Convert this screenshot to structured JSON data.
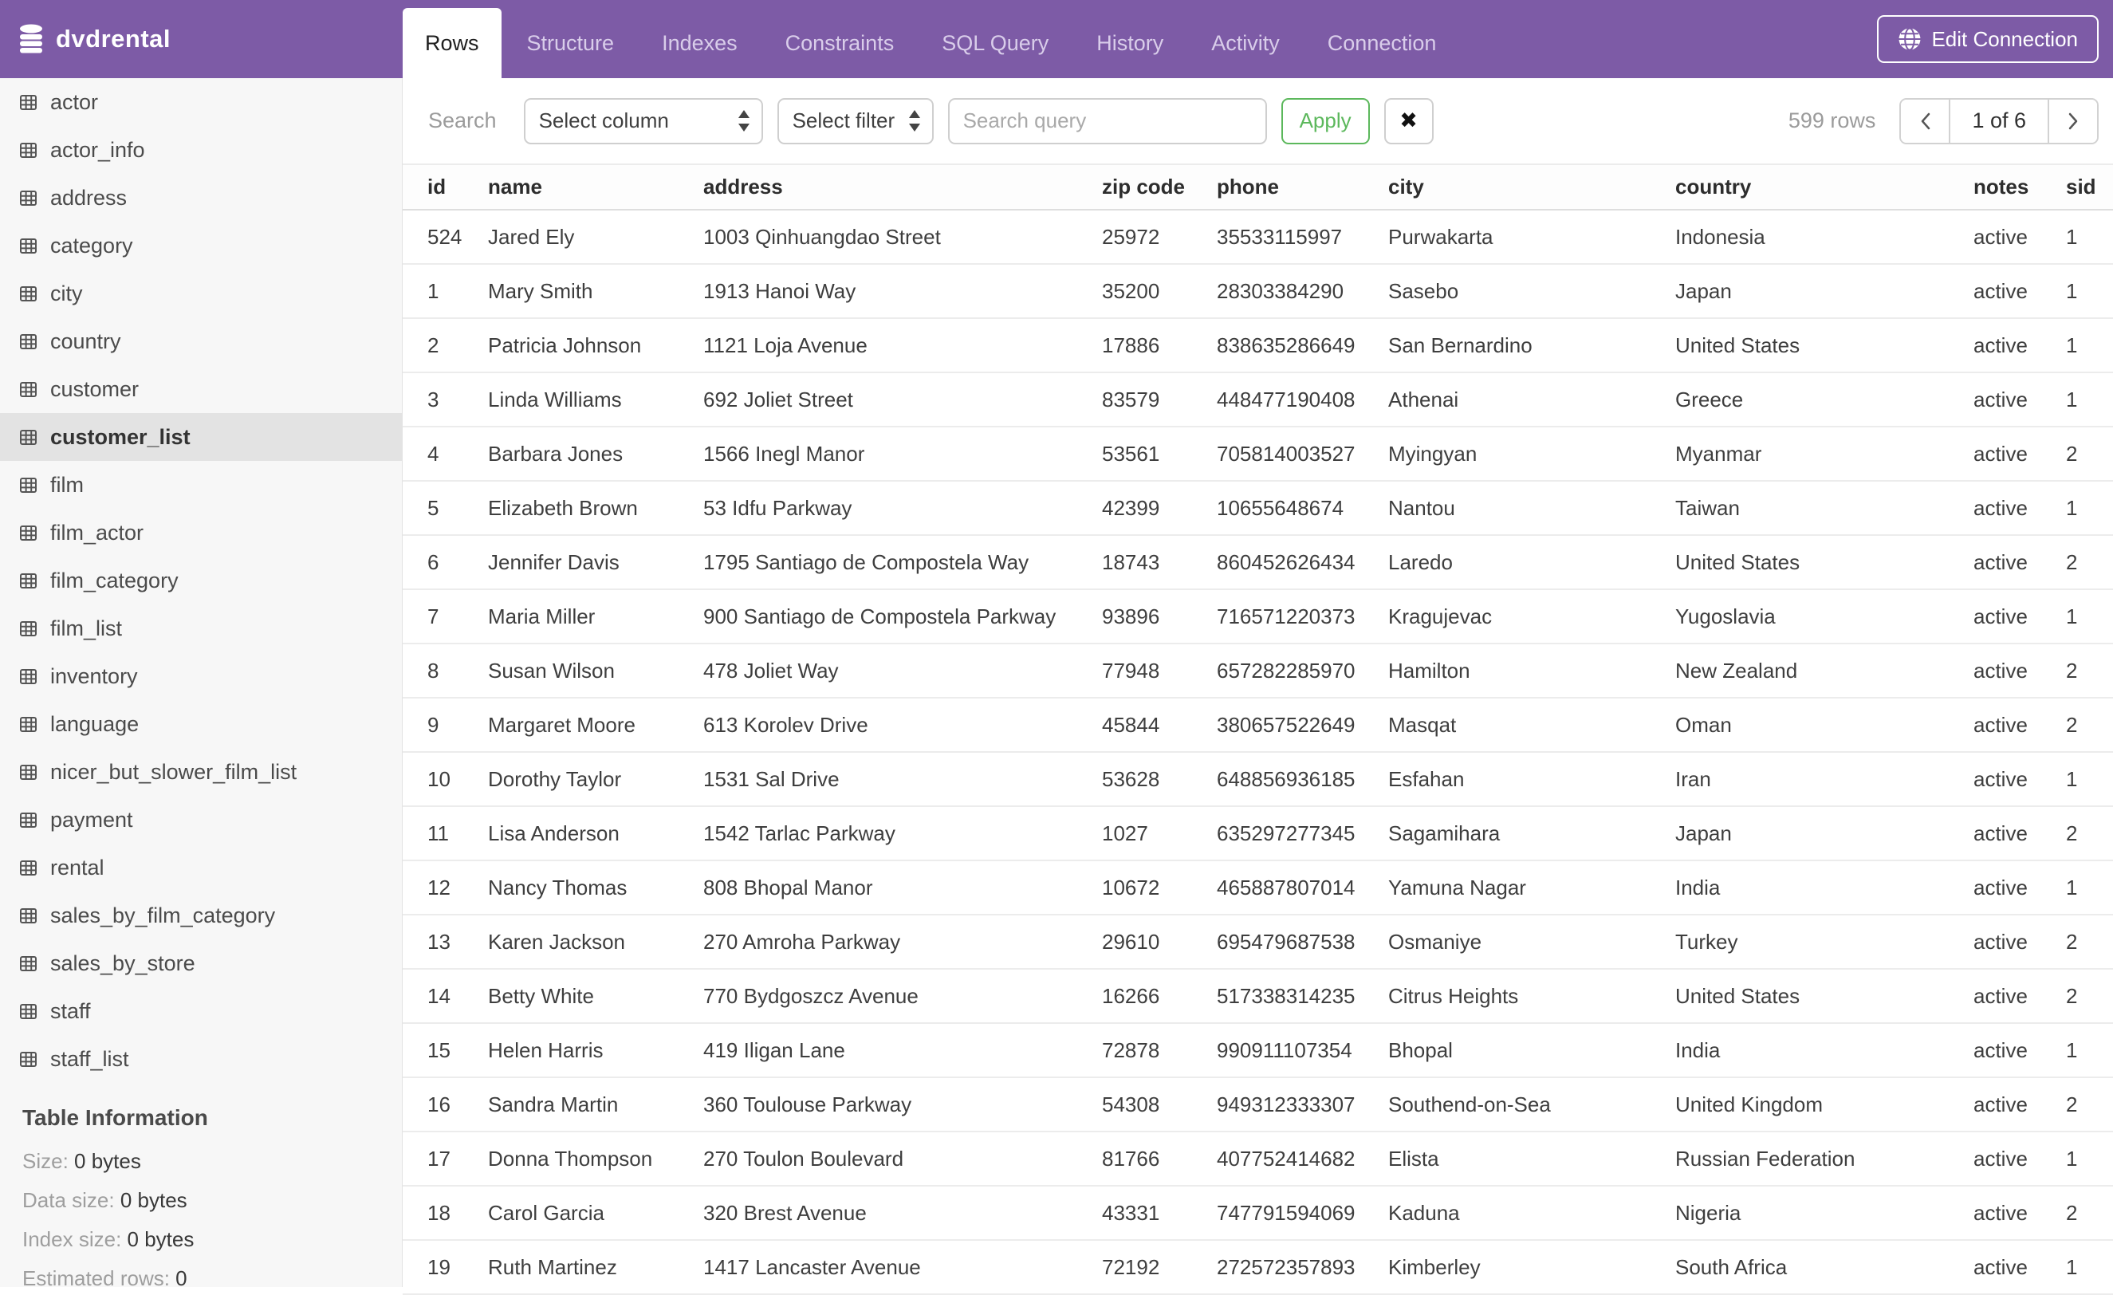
{
  "header": {
    "brand": "dvdrental",
    "tabs": [
      {
        "label": "Rows",
        "active": true
      },
      {
        "label": "Structure",
        "active": false
      },
      {
        "label": "Indexes",
        "active": false
      },
      {
        "label": "Constraints",
        "active": false
      },
      {
        "label": "SQL Query",
        "active": false
      },
      {
        "label": "History",
        "active": false
      },
      {
        "label": "Activity",
        "active": false
      },
      {
        "label": "Connection",
        "active": false
      }
    ],
    "edit_connection_label": "Edit Connection"
  },
  "toolbar": {
    "search_label": "Search",
    "column_select_value": "Select column",
    "filter_select_value": "Select filter",
    "query_placeholder": "Search query",
    "query_value": "",
    "apply_label": "Apply",
    "clear_label": "✖",
    "row_count": "599 rows",
    "page_indicator": "1 of 6"
  },
  "sidebar": {
    "selected_table": "customer_list",
    "tables": [
      "actor",
      "actor_info",
      "address",
      "category",
      "city",
      "country",
      "customer",
      "customer_list",
      "film",
      "film_actor",
      "film_category",
      "film_list",
      "inventory",
      "language",
      "nicer_but_slower_film_list",
      "payment",
      "rental",
      "sales_by_film_category",
      "sales_by_store",
      "staff",
      "staff_list"
    ],
    "info": {
      "heading": "Table Information",
      "items": [
        {
          "label": "Size:",
          "value": "0 bytes"
        },
        {
          "label": "Data size:",
          "value": "0 bytes"
        },
        {
          "label": "Index size:",
          "value": "0 bytes"
        },
        {
          "label": "Estimated rows:",
          "value": "0"
        }
      ]
    }
  },
  "table": {
    "columns": [
      "id",
      "name",
      "address",
      "zip code",
      "phone",
      "city",
      "country",
      "notes",
      "sid"
    ],
    "rows": [
      [
        "524",
        "Jared Ely",
        "1003 Qinhuangdao Street",
        "25972",
        "35533115997",
        "Purwakarta",
        "Indonesia",
        "active",
        "1"
      ],
      [
        "1",
        "Mary Smith",
        "1913 Hanoi Way",
        "35200",
        "28303384290",
        "Sasebo",
        "Japan",
        "active",
        "1"
      ],
      [
        "2",
        "Patricia Johnson",
        "1121 Loja Avenue",
        "17886",
        "838635286649",
        "San Bernardino",
        "United States",
        "active",
        "1"
      ],
      [
        "3",
        "Linda Williams",
        "692 Joliet Street",
        "83579",
        "448477190408",
        "Athenai",
        "Greece",
        "active",
        "1"
      ],
      [
        "4",
        "Barbara Jones",
        "1566 Inegl Manor",
        "53561",
        "705814003527",
        "Myingyan",
        "Myanmar",
        "active",
        "2"
      ],
      [
        "5",
        "Elizabeth Brown",
        "53 Idfu Parkway",
        "42399",
        "10655648674",
        "Nantou",
        "Taiwan",
        "active",
        "1"
      ],
      [
        "6",
        "Jennifer Davis",
        "1795 Santiago de Compostela Way",
        "18743",
        "860452626434",
        "Laredo",
        "United States",
        "active",
        "2"
      ],
      [
        "7",
        "Maria Miller",
        "900 Santiago de Compostela Parkway",
        "93896",
        "716571220373",
        "Kragujevac",
        "Yugoslavia",
        "active",
        "1"
      ],
      [
        "8",
        "Susan Wilson",
        "478 Joliet Way",
        "77948",
        "657282285970",
        "Hamilton",
        "New Zealand",
        "active",
        "2"
      ],
      [
        "9",
        "Margaret Moore",
        "613 Korolev Drive",
        "45844",
        "380657522649",
        "Masqat",
        "Oman",
        "active",
        "2"
      ],
      [
        "10",
        "Dorothy Taylor",
        "1531 Sal Drive",
        "53628",
        "648856936185",
        "Esfahan",
        "Iran",
        "active",
        "1"
      ],
      [
        "11",
        "Lisa Anderson",
        "1542 Tarlac Parkway",
        "1027",
        "635297277345",
        "Sagamihara",
        "Japan",
        "active",
        "2"
      ],
      [
        "12",
        "Nancy Thomas",
        "808 Bhopal Manor",
        "10672",
        "465887807014",
        "Yamuna Nagar",
        "India",
        "active",
        "1"
      ],
      [
        "13",
        "Karen Jackson",
        "270 Amroha Parkway",
        "29610",
        "695479687538",
        "Osmaniye",
        "Turkey",
        "active",
        "2"
      ],
      [
        "14",
        "Betty White",
        "770 Bydgoszcz Avenue",
        "16266",
        "517338314235",
        "Citrus Heights",
        "United States",
        "active",
        "2"
      ],
      [
        "15",
        "Helen Harris",
        "419 Iligan Lane",
        "72878",
        "990911107354",
        "Bhopal",
        "India",
        "active",
        "1"
      ],
      [
        "16",
        "Sandra Martin",
        "360 Toulouse Parkway",
        "54308",
        "949312333307",
        "Southend-on-Sea",
        "United Kingdom",
        "active",
        "2"
      ],
      [
        "17",
        "Donna Thompson",
        "270 Toulon Boulevard",
        "81766",
        "407752414682",
        "Elista",
        "Russian Federation",
        "active",
        "1"
      ],
      [
        "18",
        "Carol Garcia",
        "320 Brest Avenue",
        "43331",
        "747791594069",
        "Kaduna",
        "Nigeria",
        "active",
        "2"
      ],
      [
        "19",
        "Ruth Martinez",
        "1417 Lancaster Avenue",
        "72192",
        "272572357893",
        "Kimberley",
        "South Africa",
        "active",
        "1"
      ]
    ]
  },
  "colors": {
    "header_purple": "#7d5ba6",
    "tab_inactive_text": "#d9cdea",
    "apply_green": "#5cb85c",
    "sidebar_bg": "#f7f7f7",
    "selected_item_bg": "#e3e3e3"
  }
}
